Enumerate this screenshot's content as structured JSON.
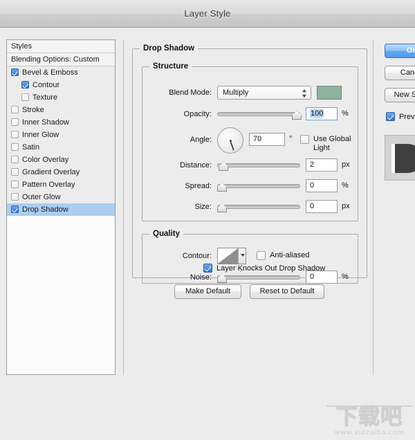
{
  "window": {
    "title": "Layer Style"
  },
  "styles_panel": {
    "header": "Styles",
    "blending_options": "Blending Options: Custom",
    "items": [
      {
        "label": "Bevel & Emboss",
        "checked": true,
        "indent": false,
        "selected": false
      },
      {
        "label": "Contour",
        "checked": true,
        "indent": true,
        "selected": false
      },
      {
        "label": "Texture",
        "checked": false,
        "indent": true,
        "selected": false
      },
      {
        "label": "Stroke",
        "checked": false,
        "indent": false,
        "selected": false
      },
      {
        "label": "Inner Shadow",
        "checked": false,
        "indent": false,
        "selected": false
      },
      {
        "label": "Inner Glow",
        "checked": false,
        "indent": false,
        "selected": false
      },
      {
        "label": "Satin",
        "checked": false,
        "indent": false,
        "selected": false
      },
      {
        "label": "Color Overlay",
        "checked": false,
        "indent": false,
        "selected": false
      },
      {
        "label": "Gradient Overlay",
        "checked": false,
        "indent": false,
        "selected": false
      },
      {
        "label": "Pattern Overlay",
        "checked": false,
        "indent": false,
        "selected": false
      },
      {
        "label": "Outer Glow",
        "checked": false,
        "indent": false,
        "selected": false
      },
      {
        "label": "Drop Shadow",
        "checked": true,
        "indent": false,
        "selected": true
      }
    ]
  },
  "main_panel": {
    "group_title": "Drop Shadow",
    "structure": {
      "title": "Structure",
      "blend_mode": {
        "label": "Blend Mode:",
        "value": "Multiply",
        "color": "#8cb39d"
      },
      "opacity": {
        "label": "Opacity:",
        "value": "100",
        "unit": "%",
        "slider_percent": 100,
        "selected": true
      },
      "angle": {
        "label": "Angle:",
        "value": "70",
        "unit": "°",
        "degrees": 70
      },
      "use_global_light": {
        "label": "Use Global Light",
        "checked": false
      },
      "distance": {
        "label": "Distance:",
        "value": "2",
        "unit": "px",
        "slider_percent": 2
      },
      "spread": {
        "label": "Spread:",
        "value": "0",
        "unit": "%",
        "slider_percent": 0
      },
      "size": {
        "label": "Size:",
        "value": "0",
        "unit": "px",
        "slider_percent": 0
      }
    },
    "quality": {
      "title": "Quality",
      "contour": {
        "label": "Contour:"
      },
      "anti_aliased": {
        "label": "Anti-aliased",
        "checked": false
      },
      "noise": {
        "label": "Noise:",
        "value": "0",
        "unit": "%",
        "slider_percent": 0
      }
    },
    "layer_knocks_out": {
      "label": "Layer Knocks Out Drop Shadow",
      "checked": true
    },
    "make_default_button": "Make Default",
    "reset_to_default_button": "Reset to Default"
  },
  "right_panel": {
    "ok_button": "OK",
    "cancel_button": "Cancel",
    "new_style_button": "New Style...",
    "preview": {
      "label": "Preview",
      "checked": true
    }
  },
  "watermark": {
    "characters": "下载吧",
    "url": "www.xiazaiba.com"
  }
}
